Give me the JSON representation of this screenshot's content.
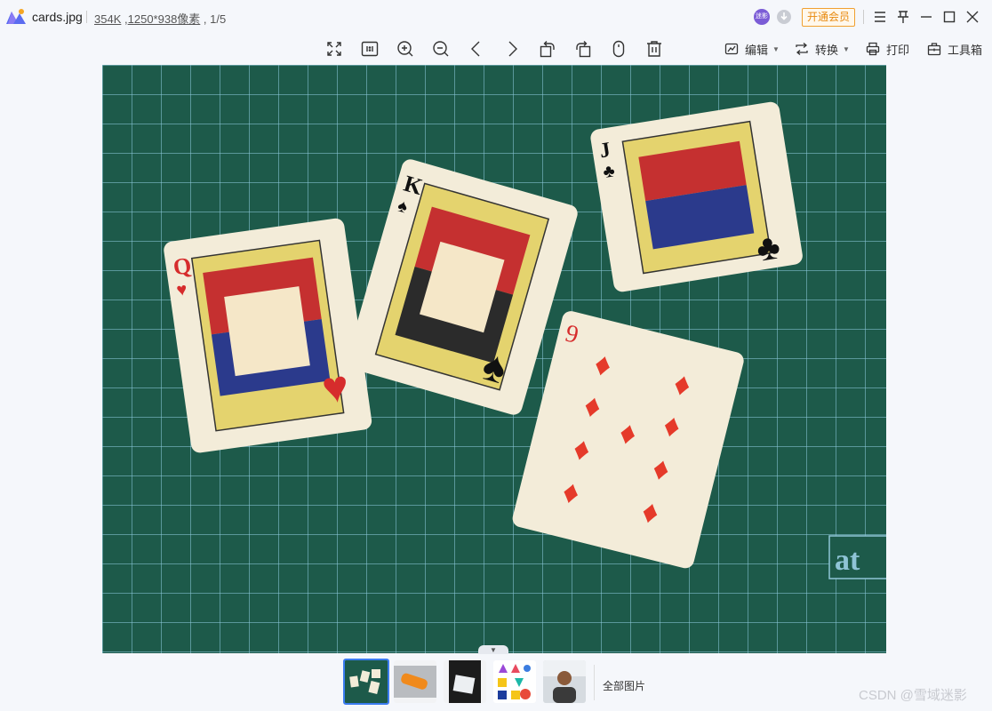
{
  "titlebar": {
    "file_name": "cards.jpg",
    "file_size": "354K",
    "dimensions": "1250*938像素",
    "position": "1/5",
    "avatar_text": "迷影",
    "vip_label": "开通会员"
  },
  "toolbar": {
    "edit_label": "编辑",
    "convert_label": "转换",
    "print_label": "打印",
    "toolbox_label": "工具箱"
  },
  "image_cards": [
    "Q♥",
    "K♠",
    "J♣",
    "9♦"
  ],
  "thumbnails": {
    "all_label": "全部图片"
  },
  "watermark": "CSDN @雪域迷影",
  "colors": {
    "accent": "#3b7cf0",
    "vip": "#e88a10",
    "mat": "#1d5a4a"
  }
}
